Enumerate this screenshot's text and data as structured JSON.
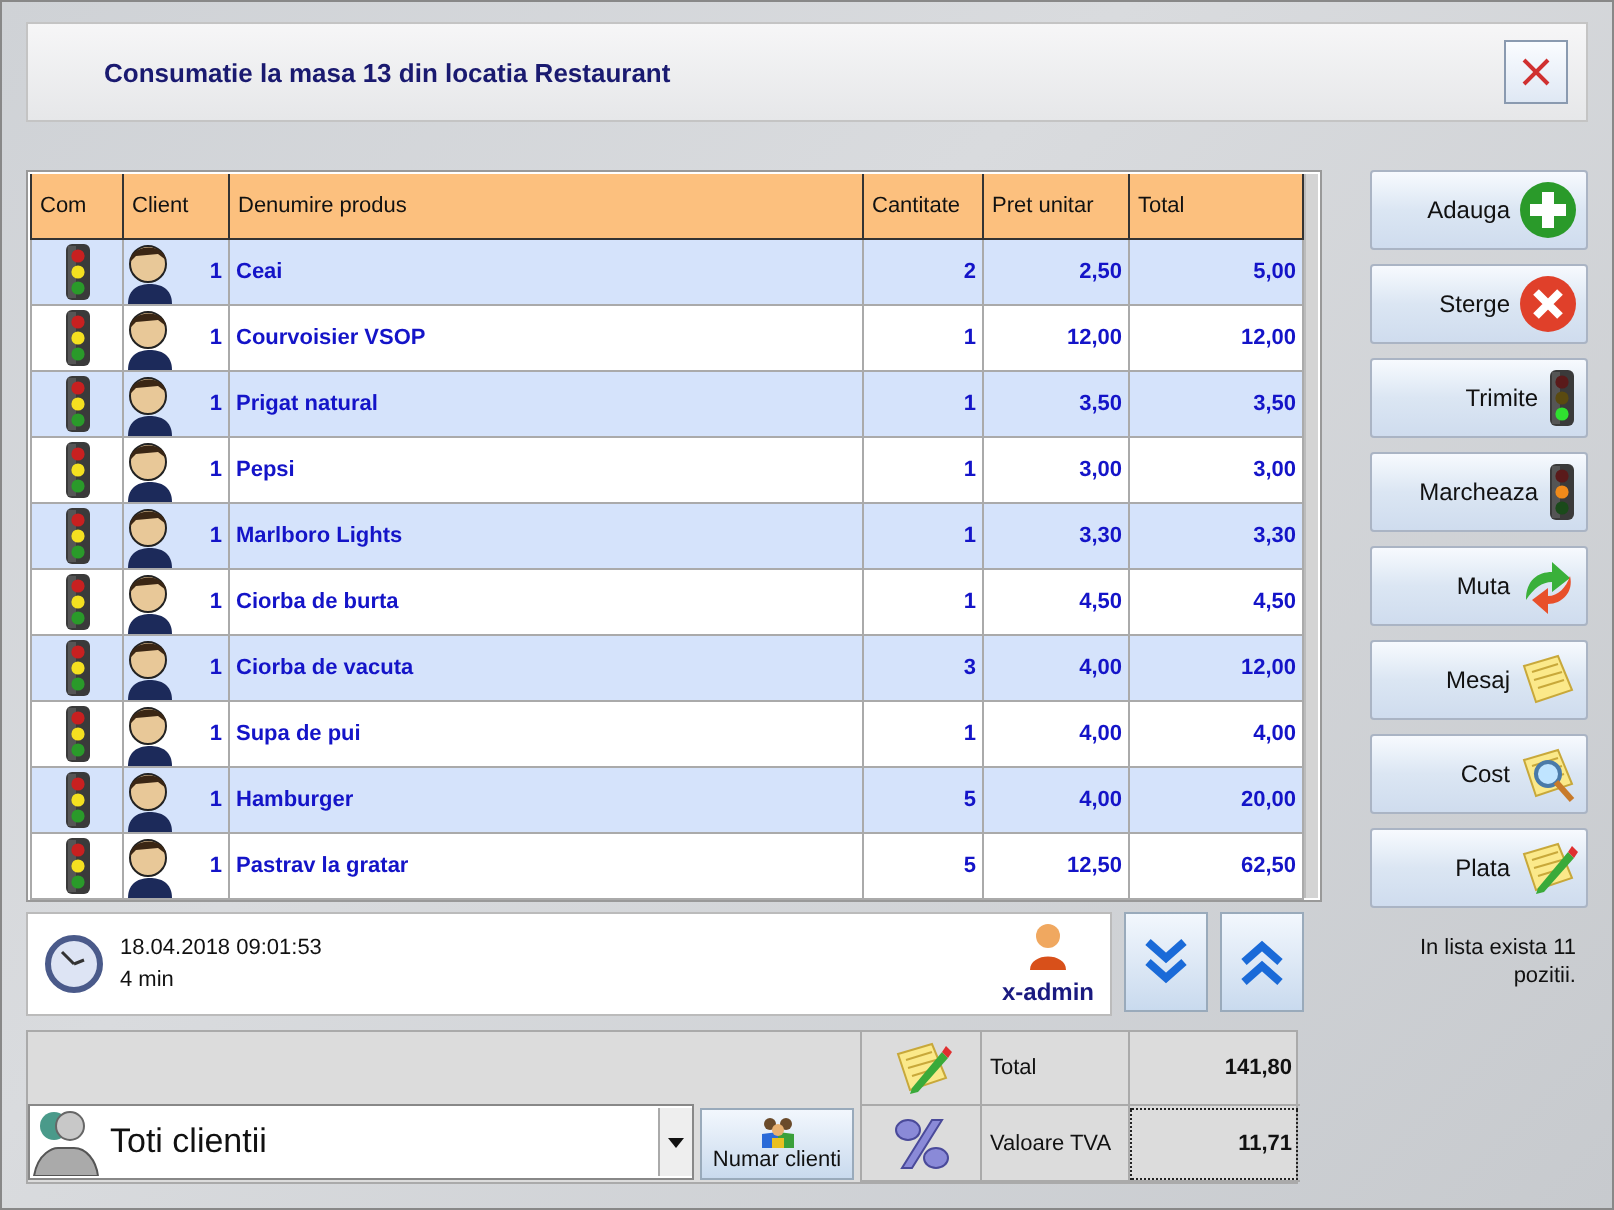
{
  "window": {
    "title": "Consumatie la masa 13 din locatia Restaurant"
  },
  "table": {
    "columns": [
      "Com",
      "Client",
      "Denumire produs",
      "Cantitate",
      "Pret unitar",
      "Total"
    ],
    "rows": [
      {
        "client": "1",
        "product": "Ceai",
        "quantity": "2",
        "unit_price": "2,50",
        "total": "5,00"
      },
      {
        "client": "1",
        "product": "Courvoisier VSOP",
        "quantity": "1",
        "unit_price": "12,00",
        "total": "12,00"
      },
      {
        "client": "1",
        "product": "Prigat natural",
        "quantity": "1",
        "unit_price": "3,50",
        "total": "3,50"
      },
      {
        "client": "1",
        "product": "Pepsi",
        "quantity": "1",
        "unit_price": "3,00",
        "total": "3,00"
      },
      {
        "client": "1",
        "product": "Marlboro Lights",
        "quantity": "1",
        "unit_price": "3,30",
        "total": "3,30"
      },
      {
        "client": "1",
        "product": "Ciorba de burta",
        "quantity": "1",
        "unit_price": "4,50",
        "total": "4,50"
      },
      {
        "client": "1",
        "product": "Ciorba de vacuta",
        "quantity": "3",
        "unit_price": "4,00",
        "total": "12,00"
      },
      {
        "client": "1",
        "product": "Supa de pui",
        "quantity": "1",
        "unit_price": "4,00",
        "total": "4,00"
      },
      {
        "client": "1",
        "product": "Hamburger",
        "quantity": "5",
        "unit_price": "4,00",
        "total": "20,00"
      },
      {
        "client": "1",
        "product": "Pastrav la gratar",
        "quantity": "5",
        "unit_price": "12,50",
        "total": "62,50"
      }
    ]
  },
  "info": {
    "datetime": "18.04.2018 09:01:53",
    "duration": "4 min",
    "user": "x-admin"
  },
  "actions": [
    {
      "label": "Adauga",
      "kind": "add"
    },
    {
      "label": "Sterge",
      "kind": "delete"
    },
    {
      "label": "Trimite",
      "kind": "send"
    },
    {
      "label": "Marcheaza",
      "kind": "mark"
    },
    {
      "label": "Muta",
      "kind": "move"
    },
    {
      "label": "Mesaj",
      "kind": "message"
    },
    {
      "label": "Cost",
      "kind": "cost"
    },
    {
      "label": "Plata",
      "kind": "pay"
    }
  ],
  "item_count": "In lista exista 11 pozitii.",
  "client_filter": {
    "value": "Toti clientii"
  },
  "client_count_button": "Numar clienti",
  "totals": [
    {
      "kind": "total",
      "label": "Total",
      "value": "141,80",
      "focused": false
    },
    {
      "kind": "vat",
      "label": "Valoare TVA",
      "value": "11,71",
      "focused": true
    }
  ]
}
